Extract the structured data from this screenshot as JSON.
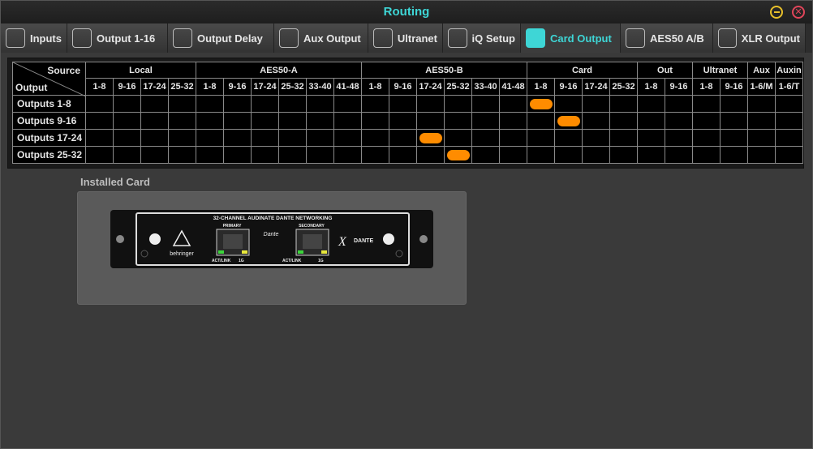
{
  "window": {
    "title": "Routing"
  },
  "tabs": [
    {
      "label": "Inputs",
      "icon": "in",
      "active": false
    },
    {
      "label": "Output 1-16",
      "icon": "out",
      "active": false
    },
    {
      "label": "Output Delay",
      "icon": "delta-t",
      "active": false
    },
    {
      "label": "Aux Output",
      "icon": "out",
      "active": false
    },
    {
      "label": "Ultranet",
      "icon": "out",
      "active": false
    },
    {
      "label": "iQ Setup",
      "icon": "speaker",
      "active": false
    },
    {
      "label": "Card Output",
      "icon": "card",
      "active": true
    },
    {
      "label": "AES50 A/B",
      "icon": "out",
      "active": false
    },
    {
      "label": "XLR Output",
      "icon": "xlr",
      "active": false
    }
  ],
  "matrix": {
    "corner_source": "Source",
    "corner_output": "Output",
    "groups": [
      {
        "label": "Local",
        "cols": [
          "1-8",
          "9-16",
          "17-24",
          "25-32"
        ]
      },
      {
        "label": "AES50-A",
        "cols": [
          "1-8",
          "9-16",
          "17-24",
          "25-32",
          "33-40",
          "41-48"
        ]
      },
      {
        "label": "AES50-B",
        "cols": [
          "1-8",
          "9-16",
          "17-24",
          "25-32",
          "33-40",
          "41-48"
        ]
      },
      {
        "label": "Card",
        "cols": [
          "1-8",
          "9-16",
          "17-24",
          "25-32"
        ]
      },
      {
        "label": "Out",
        "cols": [
          "1-8",
          "9-16"
        ]
      },
      {
        "label": "Ultranet",
        "cols": [
          "1-8",
          "9-16"
        ]
      },
      {
        "label": "Aux",
        "cols": [
          "1-6/M"
        ]
      },
      {
        "label": "Auxin",
        "cols": [
          "1-6/T"
        ]
      }
    ],
    "rows": [
      "Outputs 1-8",
      "Outputs 9-16",
      "Outputs 17-24",
      "Outputs 25-32"
    ],
    "routes": [
      {
        "row": 0,
        "col": 16
      },
      {
        "row": 1,
        "col": 17
      },
      {
        "row": 2,
        "col": 12
      },
      {
        "row": 3,
        "col": 13
      }
    ],
    "accent": "#ff8c00"
  },
  "installed_card": {
    "label": "Installed Card",
    "card_title": "32-CHANNEL AUDINATE DANTE NETWORKING",
    "brand": "behringer",
    "port_primary": "PRIMARY",
    "port_secondary": "SECONDARY",
    "led_left": "ACT/LINK",
    "led_right": "1G",
    "dante_logo": "Dante",
    "xdante_logo": "DANTE"
  },
  "colors": {
    "title": "#3ed6d6",
    "active_tab": "#3ed6d6",
    "route": "#ff8c00"
  }
}
